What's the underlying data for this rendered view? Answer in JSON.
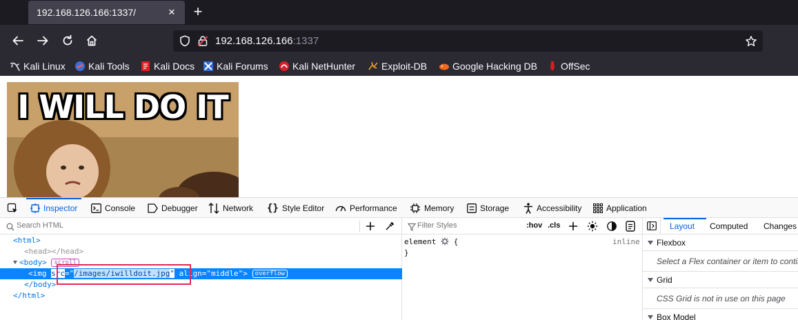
{
  "browser": {
    "tab_title": "192.168.126.166:1337/",
    "tab_close": "✕",
    "new_tab": "+",
    "url_host": "192.168.126.166",
    "url_port": ":1337"
  },
  "bookmarks": [
    {
      "label": "Kali Linux",
      "icon": "kali-dragon-icon"
    },
    {
      "label": "Kali Tools",
      "icon": "kali-tools-icon"
    },
    {
      "label": "Kali Docs",
      "icon": "kali-docs-icon"
    },
    {
      "label": "Kali Forums",
      "icon": "kali-forums-icon"
    },
    {
      "label": "Kali NetHunter",
      "icon": "kali-nethunter-icon"
    },
    {
      "label": "Exploit-DB",
      "icon": "exploit-db-icon"
    },
    {
      "label": "Google Hacking DB",
      "icon": "ghdb-icon"
    },
    {
      "label": "OffSec",
      "icon": "offsec-icon"
    }
  ],
  "page": {
    "meme_text": "I WILL DO IT"
  },
  "devtools": {
    "tabs": [
      "Inspector",
      "Console",
      "Debugger",
      "Network",
      "Style Editor",
      "Performance",
      "Memory",
      "Storage",
      "Accessibility",
      "Application"
    ],
    "active_tab": "Inspector",
    "search_html_placeholder": "Search HTML",
    "filter_styles_placeholder": "Filter Styles",
    "hov": ":hov",
    "cls": ".cls",
    "rule_selector": "element",
    "rule_open": "{",
    "rule_close": "}",
    "rule_source": "inline",
    "markup": {
      "html_open": "<html>",
      "head": "<head></head>",
      "body_open": "<body>",
      "body_badge": "scroll",
      "img_tag_open": "<img ",
      "img_src_attr": "src",
      "img_src_eq": "=\"",
      "img_src_value": "/images/iwilldoit.jpg",
      "img_src_close": "\"",
      "img_align_attr": " align",
      "img_align_value": "=\"middle\"",
      "img_tag_close": ">",
      "img_badge": "overflow",
      "body_close": "</body>",
      "html_close": "</html>"
    },
    "layout": {
      "tabs": [
        "Layout",
        "Computed",
        "Changes"
      ],
      "flexbox_title": "Flexbox",
      "flexbox_text": "Select a Flex container or item to continue.",
      "grid_title": "Grid",
      "grid_text": "CSS Grid is not in use on this page",
      "boxmodel_title": "Box Model"
    }
  },
  "colors": {
    "accent": "#0060df",
    "selection": "#0a84ff",
    "highlight_box": "#e22850"
  }
}
